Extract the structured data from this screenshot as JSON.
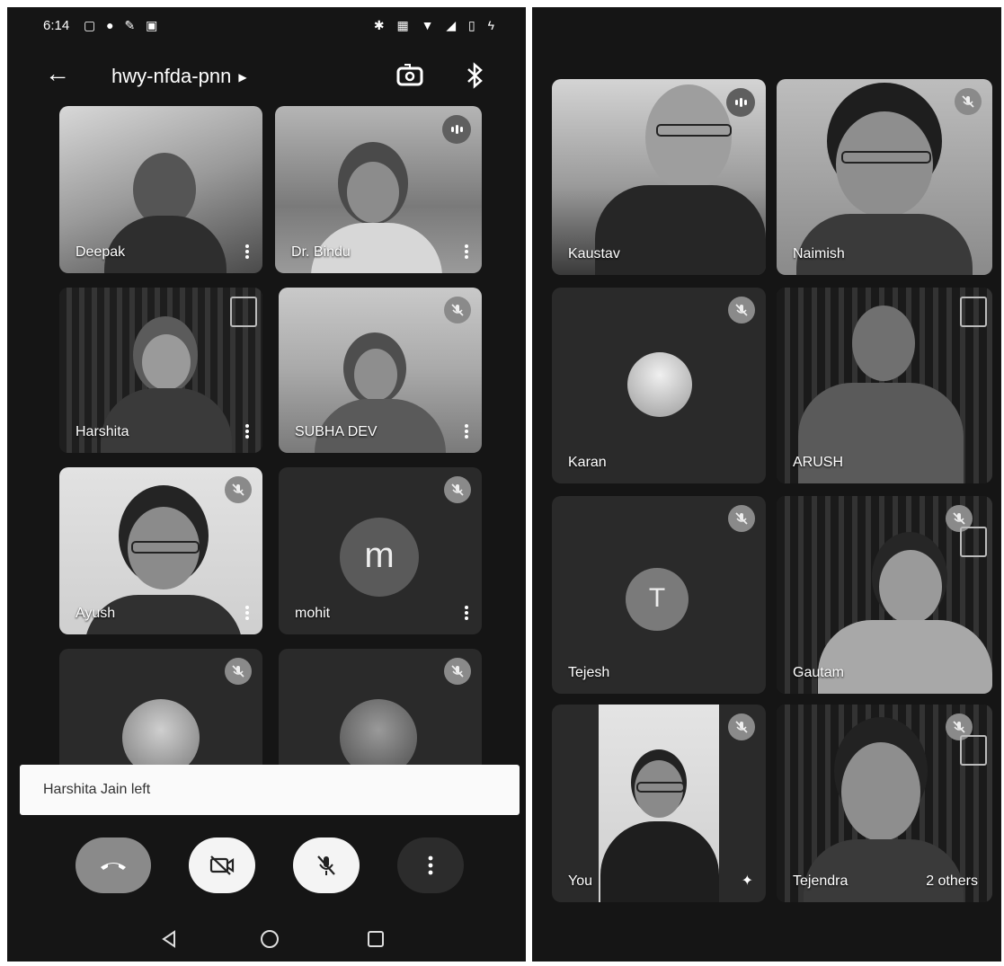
{
  "left_screen": {
    "status": {
      "time": "6:14"
    },
    "meeting_code": "hwy-nfda-pnn",
    "participants": [
      {
        "name": "Deepak"
      },
      {
        "name": "Dr. Bindu"
      },
      {
        "name": "Harshita"
      },
      {
        "name": "SUBHA DEV"
      },
      {
        "name": "Ayush"
      },
      {
        "name": "mohit",
        "initial": "m"
      }
    ],
    "toast": "Harshita Jain left"
  },
  "right_screen": {
    "participants": [
      {
        "name": "Kaustav"
      },
      {
        "name": "Naimish"
      },
      {
        "name": "Karan"
      },
      {
        "name": "ARUSH"
      },
      {
        "name": "Tejesh",
        "initial": "T"
      },
      {
        "name": "Gautam"
      },
      {
        "name": "You"
      },
      {
        "name": "Tejendra"
      }
    ],
    "others_count": "2 others"
  },
  "icons": {
    "back": "arrow-left-icon",
    "switch_camera": "camera-flip-icon",
    "bluetooth": "bluetooth-icon",
    "mute": "mic-off-icon",
    "hang_up": "phone-hangup-icon",
    "camera_off": "camera-off-icon",
    "more": "more-vert-icon"
  },
  "colors": {
    "background": "#151515",
    "hangup": "#8a8a8a",
    "toast": "#fafafa"
  }
}
